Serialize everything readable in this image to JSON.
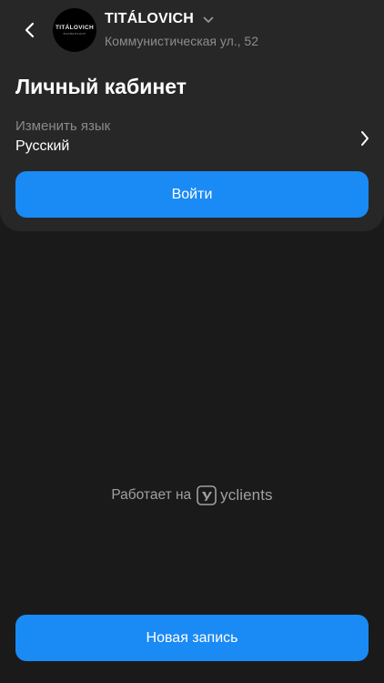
{
  "header": {
    "company_name": "TITÁLOVICH",
    "address": "Коммунистическая ул., 52",
    "logo": {
      "text": "TITÁLOVICH",
      "subtext": "BARBERSHOP"
    }
  },
  "profile": {
    "title": "Личный кабинет",
    "language_caption": "Изменить язык",
    "language_value": "Русский",
    "login_label": "Войти"
  },
  "footer": {
    "powered_by_label": "Работает на",
    "brand": "yclients",
    "new_booking_label": "Новая запись"
  },
  "colors": {
    "background": "#1a1a1a",
    "card": "#272727",
    "accent": "#1a8af5",
    "muted_text": "#8c8c8c"
  },
  "icons": {
    "back": "chevron-left-icon",
    "company_switch": "chevron-down-icon",
    "language_arrow": "chevron-right-icon",
    "brand": "yclients-logo-icon"
  }
}
